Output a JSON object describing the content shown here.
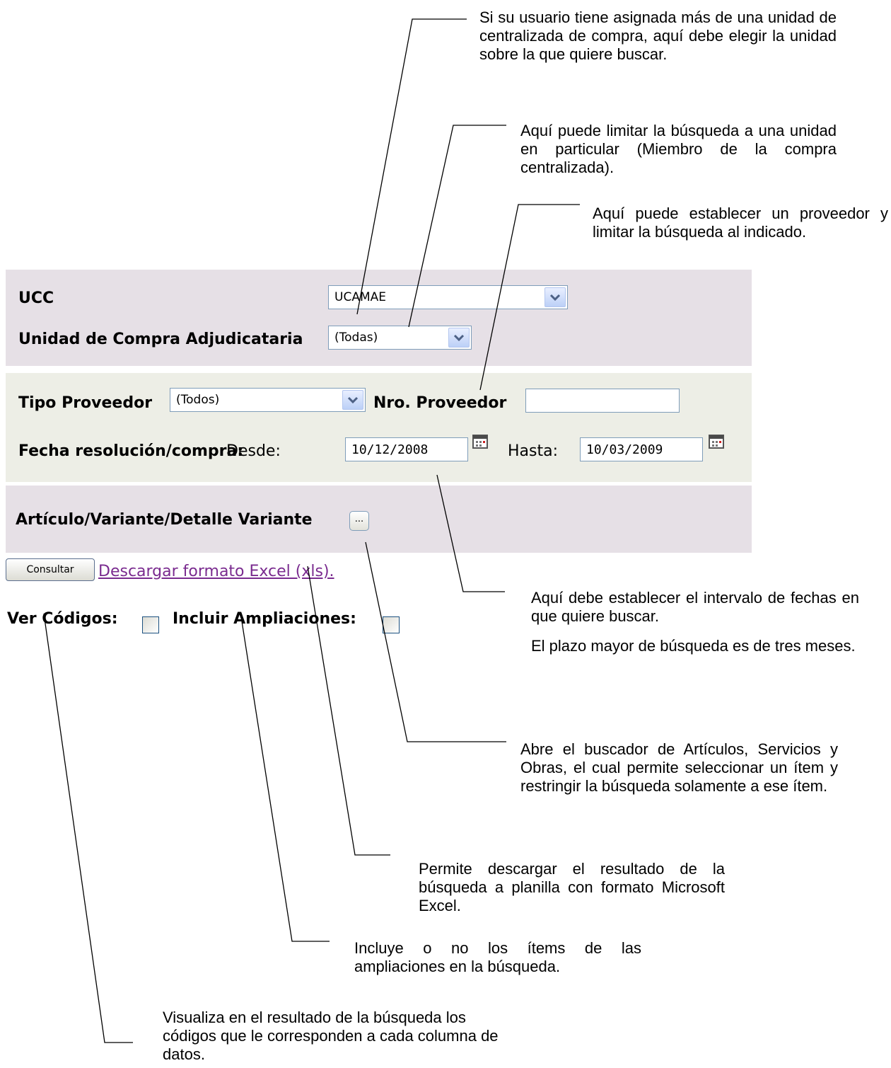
{
  "annotations": {
    "ucc_note": "Si su usuario tiene asignada más de una unidad de centralizada de compra, aquí debe elegir la unidad sobre la que quiere buscar.",
    "unidad_note": "Aquí puede limitar la búsqueda a una unidad en particular (Miembro de la compra centralizada).",
    "proveedor_note": "Aquí puede establecer un proveedor y limitar la búsqueda al indicado.",
    "fechas_note_1": "Aquí debe establecer el intervalo de fechas en que quiere buscar.",
    "fechas_note_2": "El plazo mayor de búsqueda es de tres meses.",
    "articulo_note": "Abre el buscador de Artículos, Servicios y Obras, el cual permite seleccionar un ítem y restringir la búsqueda solamente a ese ítem.",
    "excel_note": "Permite descargar el resultado de la búsqueda a planilla con formato Microsoft Excel.",
    "ampliaciones_note": "Incluye o no los ítems de las ampliaciones en la búsqueda.",
    "codigos_note": "Visualiza en el resultado de la búsqueda los códigos que le corresponden a cada columna de datos."
  },
  "form": {
    "ucc_label": "UCC",
    "ucc_value": "UCAMAE",
    "unidad_label": "Unidad de Compra Adjudicataria",
    "unidad_value": "(Todas)",
    "tipo_proveedor_label": "Tipo Proveedor",
    "tipo_proveedor_value": "(Todos)",
    "nro_proveedor_label": "Nro. Proveedor",
    "nro_proveedor_value": "",
    "fecha_label": "Fecha resolución/compra:",
    "desde_label": "Desde:",
    "desde_value": "10/12/2008",
    "hasta_label": "Hasta:",
    "hasta_value": "10/03/2009",
    "articulo_label": "Artículo/Variante/Detalle Variante",
    "articulo_button": "...",
    "consultar_button": "Consultar",
    "excel_link": "Descargar formato Excel (xls).",
    "ver_codigos_label": "Ver Códigos:",
    "ver_codigos_checked": false,
    "incluir_ampliaciones_label": "Incluir Ampliaciones:",
    "incluir_ampliaciones_checked": false
  },
  "colors": {
    "panel_lilac": "#e6e0e6",
    "panel_beige": "#edeee6",
    "link": "#7a2b8f",
    "input_border": "#7f9db9"
  },
  "icons": [
    "chevron-down-icon",
    "calendar-icon"
  ]
}
